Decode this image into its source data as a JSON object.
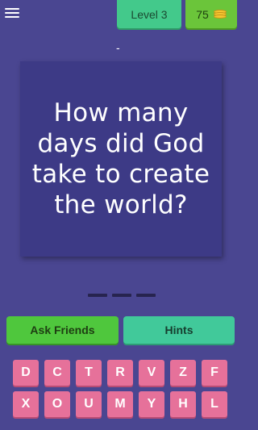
{
  "header": {
    "level_label": "Level 3",
    "coins": "75",
    "coin_icon": "coins-icon",
    "menu_icon": "hamburger-menu-icon"
  },
  "top_marker": "-",
  "question": {
    "text": "How many days did God take to create the world?"
  },
  "answer": {
    "length": 3
  },
  "actions": {
    "ask_friends": "Ask Friends",
    "hints": "Hints"
  },
  "keyboard": {
    "row1": [
      "D",
      "C",
      "T",
      "R",
      "V",
      "Z",
      "F"
    ],
    "row2": [
      "X",
      "O",
      "U",
      "M",
      "Y",
      "H",
      "L"
    ]
  },
  "colors": {
    "background": "#4a4691",
    "card": "#3d3a86",
    "level_badge": "#43c98b",
    "coins_badge": "#6bc53a",
    "ask_button": "#4fc73d",
    "hints_button": "#41c99a",
    "key": "#e6719a"
  }
}
